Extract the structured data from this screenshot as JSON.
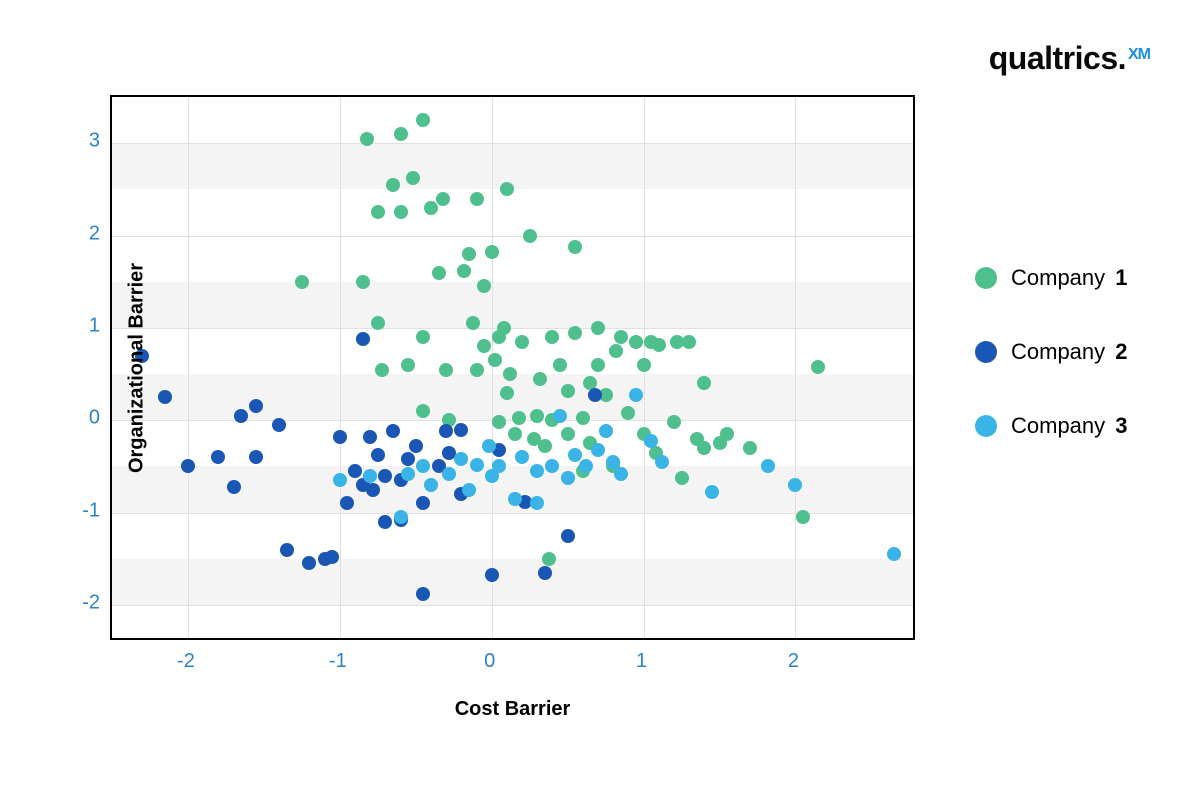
{
  "logo": {
    "word": "qualtrics.",
    "xm": "XM"
  },
  "legend": [
    {
      "label_prefix": "Company ",
      "label_num": "1",
      "color": "#4fc08d"
    },
    {
      "label_prefix": "Company ",
      "label_num": "2",
      "color": "#1a56b4"
    },
    {
      "label_prefix": "Company ",
      "label_num": "3",
      "color": "#3ab4e6"
    }
  ],
  "chart_data": {
    "type": "scatter",
    "xlabel": "Cost Barrier",
    "ylabel": "Organizational Barrier",
    "title": "",
    "xlim": [
      -2.5,
      2.8
    ],
    "ylim": [
      -2.4,
      3.5
    ],
    "x_ticks": [
      -2,
      -1,
      0,
      1,
      2
    ],
    "y_ticks": [
      -2,
      -1,
      0,
      1,
      2,
      3
    ],
    "grid": {
      "x": [
        -2,
        -1,
        0,
        1,
        2
      ],
      "y": [
        -2,
        -1,
        0,
        1,
        2,
        3
      ]
    },
    "bands": [
      [
        -2.0,
        -1.5
      ],
      [
        -1.0,
        -0.5
      ],
      [
        0.0,
        0.5
      ],
      [
        1.0,
        1.5
      ],
      [
        2.5,
        3.0
      ]
    ],
    "series": [
      {
        "name": "Company 1",
        "color": "#4fc08d",
        "points": [
          [
            -1.25,
            1.5
          ],
          [
            -0.85,
            1.5
          ],
          [
            -0.82,
            3.05
          ],
          [
            -0.75,
            2.25
          ],
          [
            -0.75,
            1.05
          ],
          [
            -0.72,
            0.55
          ],
          [
            -0.65,
            2.55
          ],
          [
            -0.6,
            3.1
          ],
          [
            -0.6,
            2.25
          ],
          [
            -0.55,
            0.6
          ],
          [
            -0.52,
            2.62
          ],
          [
            -0.45,
            0.9
          ],
          [
            -0.45,
            0.1
          ],
          [
            -0.45,
            3.25
          ],
          [
            -0.4,
            2.3
          ],
          [
            -0.35,
            1.6
          ],
          [
            -0.32,
            2.4
          ],
          [
            -0.3,
            0.55
          ],
          [
            -0.28,
            0.0
          ],
          [
            -0.18,
            1.62
          ],
          [
            -0.15,
            1.8
          ],
          [
            -0.12,
            1.05
          ],
          [
            -0.1,
            0.55
          ],
          [
            -0.1,
            2.4
          ],
          [
            -0.05,
            1.45
          ],
          [
            -0.05,
            0.8
          ],
          [
            0.0,
            1.82
          ],
          [
            0.02,
            0.65
          ],
          [
            0.05,
            0.9
          ],
          [
            0.05,
            -0.02
          ],
          [
            0.08,
            1.0
          ],
          [
            0.1,
            0.3
          ],
          [
            0.1,
            2.5
          ],
          [
            0.12,
            0.5
          ],
          [
            0.15,
            -0.15
          ],
          [
            0.18,
            0.02
          ],
          [
            0.2,
            0.85
          ],
          [
            0.25,
            2.0
          ],
          [
            0.28,
            -0.2
          ],
          [
            0.3,
            0.05
          ],
          [
            0.32,
            0.45
          ],
          [
            0.35,
            -0.28
          ],
          [
            0.38,
            -1.5
          ],
          [
            0.4,
            0.0
          ],
          [
            0.4,
            0.9
          ],
          [
            0.45,
            0.6
          ],
          [
            0.5,
            0.32
          ],
          [
            0.5,
            -0.15
          ],
          [
            0.55,
            1.88
          ],
          [
            0.55,
            0.95
          ],
          [
            0.6,
            -0.55
          ],
          [
            0.6,
            0.02
          ],
          [
            0.65,
            0.4
          ],
          [
            0.65,
            -0.25
          ],
          [
            0.7,
            0.6
          ],
          [
            0.7,
            1.0
          ],
          [
            0.75,
            0.27
          ],
          [
            0.8,
            -0.5
          ],
          [
            0.82,
            0.75
          ],
          [
            0.85,
            0.9
          ],
          [
            0.9,
            0.08
          ],
          [
            0.95,
            0.85
          ],
          [
            1.0,
            0.6
          ],
          [
            1.0,
            -0.15
          ],
          [
            1.05,
            0.85
          ],
          [
            1.08,
            -0.35
          ],
          [
            1.1,
            0.82
          ],
          [
            1.2,
            -0.02
          ],
          [
            1.22,
            0.85
          ],
          [
            1.25,
            -0.62
          ],
          [
            1.3,
            0.85
          ],
          [
            1.35,
            -0.2
          ],
          [
            1.4,
            -0.3
          ],
          [
            1.4,
            0.4
          ],
          [
            1.5,
            -0.25
          ],
          [
            1.55,
            -0.15
          ],
          [
            1.7,
            -0.3
          ],
          [
            2.05,
            -1.05
          ],
          [
            2.15,
            0.58
          ]
        ]
      },
      {
        "name": "Company 2",
        "color": "#1a56b4",
        "points": [
          [
            -2.3,
            0.7
          ],
          [
            -2.15,
            0.25
          ],
          [
            -2.0,
            -0.5
          ],
          [
            -1.8,
            -0.4
          ],
          [
            -1.7,
            -0.72
          ],
          [
            -1.65,
            0.05
          ],
          [
            -1.55,
            0.15
          ],
          [
            -1.55,
            -0.4
          ],
          [
            -1.4,
            -0.05
          ],
          [
            -1.35,
            -1.4
          ],
          [
            -1.2,
            -1.55
          ],
          [
            -1.1,
            -1.5
          ],
          [
            -1.05,
            -1.48
          ],
          [
            -1.0,
            -0.18
          ],
          [
            -0.95,
            -0.9
          ],
          [
            -0.9,
            -0.55
          ],
          [
            -0.85,
            -0.7
          ],
          [
            -0.85,
            0.88
          ],
          [
            -0.8,
            -0.18
          ],
          [
            -0.78,
            -0.75
          ],
          [
            -0.75,
            -0.38
          ],
          [
            -0.7,
            -0.6
          ],
          [
            -0.7,
            -1.1
          ],
          [
            -0.65,
            -0.12
          ],
          [
            -0.6,
            -0.65
          ],
          [
            -0.6,
            -1.08
          ],
          [
            -0.55,
            -0.42
          ],
          [
            -0.5,
            -0.28
          ],
          [
            -0.45,
            -0.9
          ],
          [
            -0.45,
            -1.88
          ],
          [
            -0.35,
            -0.5
          ],
          [
            -0.3,
            -0.12
          ],
          [
            -0.28,
            -0.35
          ],
          [
            -0.2,
            -0.1
          ],
          [
            -0.2,
            -0.8
          ],
          [
            0.0,
            -1.68
          ],
          [
            0.05,
            -0.32
          ],
          [
            0.22,
            -0.88
          ],
          [
            0.35,
            -1.65
          ],
          [
            0.5,
            -1.25
          ],
          [
            0.68,
            0.27
          ]
        ]
      },
      {
        "name": "Company 3",
        "color": "#3ab4e6",
        "points": [
          [
            -1.0,
            -0.65
          ],
          [
            -0.8,
            -0.6
          ],
          [
            -0.6,
            -1.05
          ],
          [
            -0.55,
            -0.58
          ],
          [
            -0.45,
            -0.5
          ],
          [
            -0.4,
            -0.7
          ],
          [
            -0.28,
            -0.58
          ],
          [
            -0.2,
            -0.42
          ],
          [
            -0.15,
            -0.75
          ],
          [
            -0.1,
            -0.48
          ],
          [
            -0.02,
            -0.28
          ],
          [
            0.0,
            -0.6
          ],
          [
            0.05,
            -0.5
          ],
          [
            0.15,
            -0.85
          ],
          [
            0.2,
            -0.4
          ],
          [
            0.3,
            -0.55
          ],
          [
            0.3,
            -0.9
          ],
          [
            0.4,
            -0.5
          ],
          [
            0.45,
            0.05
          ],
          [
            0.5,
            -0.62
          ],
          [
            0.55,
            -0.38
          ],
          [
            0.62,
            -0.5
          ],
          [
            0.7,
            -0.32
          ],
          [
            0.75,
            -0.12
          ],
          [
            0.8,
            -0.45
          ],
          [
            0.85,
            -0.58
          ],
          [
            0.95,
            0.27
          ],
          [
            1.05,
            -0.22
          ],
          [
            1.12,
            -0.45
          ],
          [
            1.45,
            -0.78
          ],
          [
            1.82,
            -0.5
          ],
          [
            2.0,
            -0.7
          ],
          [
            2.65,
            -1.45
          ]
        ]
      }
    ]
  }
}
